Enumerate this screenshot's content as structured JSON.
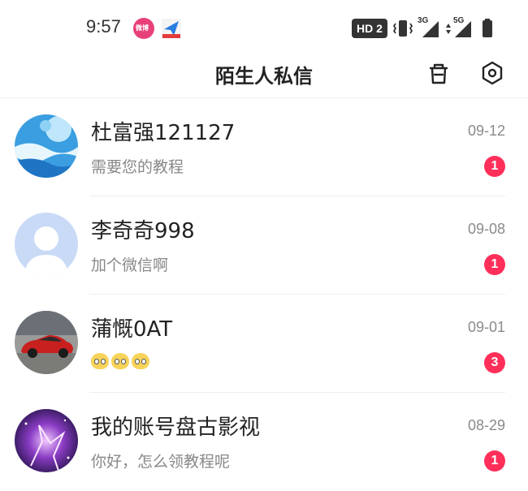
{
  "status_bar": {
    "time": "9:57",
    "hd_label": "HD 2",
    "app_icons": [
      "weibo-app-icon",
      "message-app-icon"
    ],
    "signal_1_label": "3G",
    "signal_2_label": "5G"
  },
  "header": {
    "title": "陌生人私信"
  },
  "conversations": [
    {
      "name": "杜富强121127",
      "message": "需要您的教程",
      "date": "09-12",
      "unread": "1",
      "avatar": "blue-abstract-avatar"
    },
    {
      "name": "李奇奇998",
      "message": "加个微信啊",
      "date": "09-08",
      "unread": "1",
      "avatar": "default-person-avatar"
    },
    {
      "name": "蒲慨0AT",
      "message": "",
      "emojis": [
        "face-emoji",
        "face-emoji",
        "face-emoji"
      ],
      "date": "09-01",
      "unread": "3",
      "avatar": "red-car-avatar"
    },
    {
      "name": "我的账号盘古影视",
      "message": "你好，怎么领教程呢",
      "date": "08-29",
      "unread": "1",
      "avatar": "purple-galaxy-avatar"
    }
  ],
  "colors": {
    "badge": "#ff2f5a",
    "title": "#222222",
    "subtext": "#888888",
    "divider": "#eeeeee"
  }
}
